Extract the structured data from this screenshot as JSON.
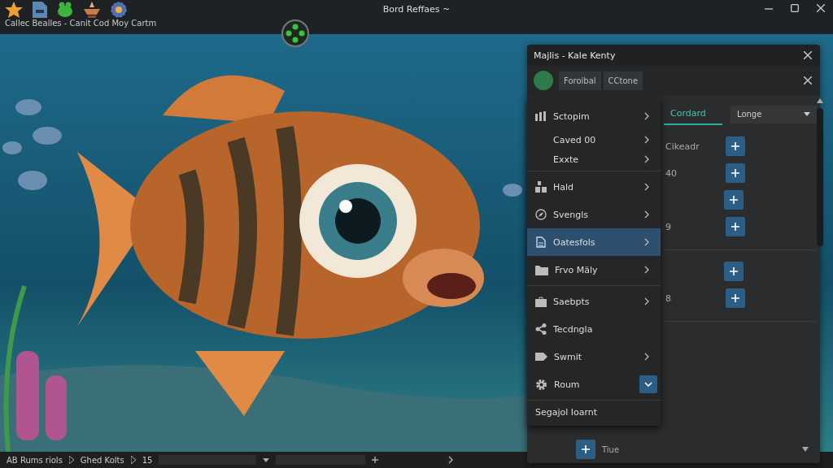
{
  "window": {
    "title": "Bord Reffaes ~",
    "subtitle": "Callec Bealles - Canit Cod  Moy Cartm"
  },
  "panel": {
    "title": "Majlis - Kale Kenty",
    "buttons": [
      "Foroibal",
      "CCtone"
    ],
    "tab": "Cordard",
    "dropdown": "Longe",
    "groups": [
      [
        {
          "kind": "labeled",
          "text": "Cikeadr"
        },
        {
          "kind": "labeled",
          "text": "40"
        },
        {
          "kind": "bare"
        },
        {
          "kind": "labeled",
          "text": "9"
        }
      ],
      [
        {
          "kind": "bare"
        },
        {
          "kind": "labeled",
          "text": "8"
        }
      ]
    ],
    "footer": "Tiue"
  },
  "menu": {
    "groups": [
      [
        {
          "label": "Sctopim",
          "kind": "submenu",
          "selected": false
        },
        {
          "label": "Caved 00",
          "kind": "submenu",
          "selected": false
        },
        {
          "label": "Exxte",
          "kind": "submenu",
          "selected": false
        }
      ],
      [
        {
          "label": "Hald",
          "kind": "submenu",
          "selected": false
        },
        {
          "label": "Svengls",
          "kind": "submenu",
          "selected": false
        },
        {
          "label": "Oatesfols",
          "kind": "submenu",
          "selected": true
        },
        {
          "label": "Frvo Mäly",
          "kind": "submenu",
          "selected": false
        }
      ],
      [
        {
          "label": "Saebpts",
          "kind": "submenu",
          "selected": false
        },
        {
          "label": "Tecdngla",
          "kind": "plain",
          "selected": false
        },
        {
          "label": "Swmit",
          "kind": "submenu",
          "selected": false
        },
        {
          "label": "Roum",
          "kind": "dropdown",
          "selected": false
        }
      ]
    ],
    "footer": "Segajol Ioarnt"
  },
  "status_bar": {
    "items": [
      "AB Rums riols",
      "Ghed Kolts",
      "15"
    ]
  }
}
